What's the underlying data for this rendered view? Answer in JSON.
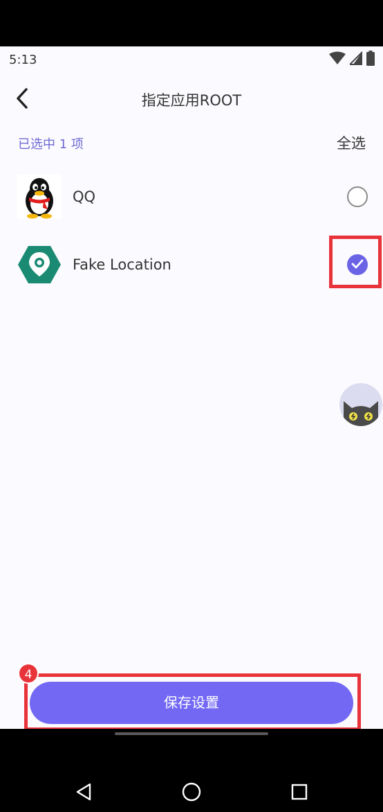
{
  "status_bar": {
    "time": "5:13",
    "icons": [
      "wifi-icon",
      "signal-icon",
      "battery-icon"
    ]
  },
  "header": {
    "title": "指定应用ROOT",
    "back_icon": "chevron-left-icon"
  },
  "selection": {
    "count_text": "已选中 1 项",
    "select_all_label": "全选"
  },
  "apps": [
    {
      "name": "QQ",
      "icon": "qq-penguin-icon",
      "selected": false
    },
    {
      "name": "Fake Location",
      "icon": "fake-location-icon",
      "selected": true
    }
  ],
  "footer": {
    "save_label": "保存设置",
    "step_badge": "4"
  },
  "colors": {
    "accent": "#7268f4",
    "highlight": "#e8333a",
    "count_text": "#6e6ad6",
    "fake_location_green": "#1a8a73"
  },
  "nav_bar": {
    "buttons": [
      "back-triangle-icon",
      "home-circle-icon",
      "recents-square-icon"
    ]
  }
}
